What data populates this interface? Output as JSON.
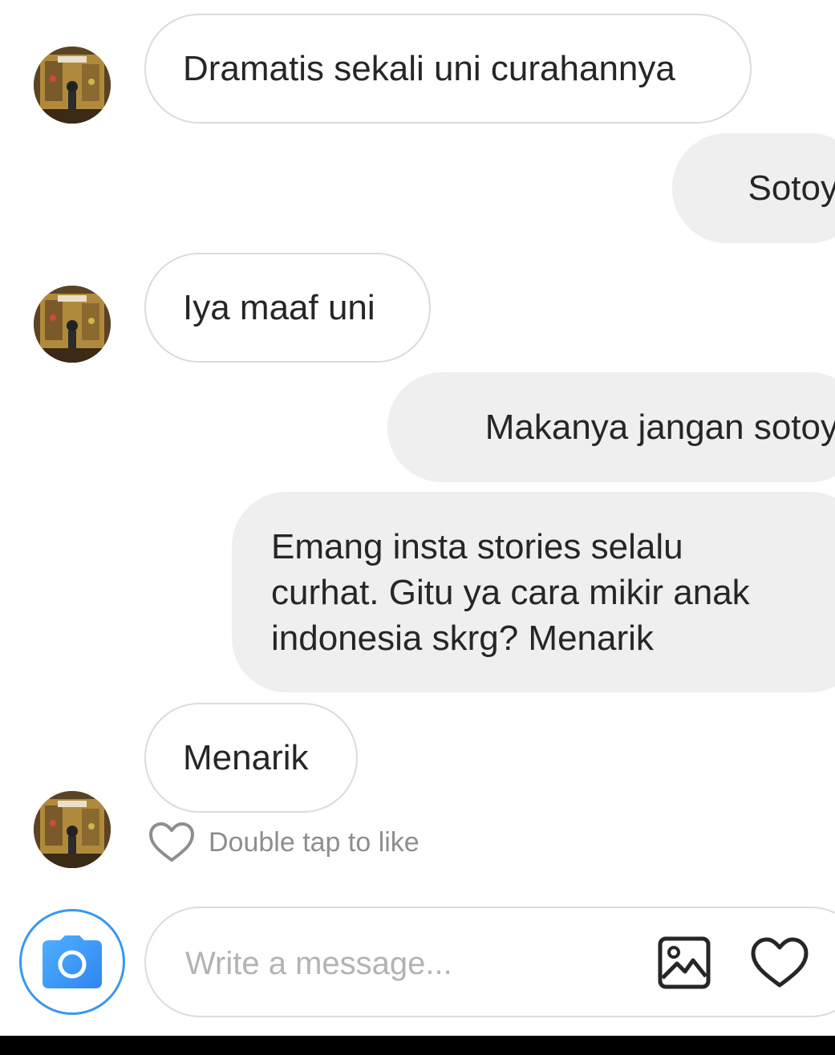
{
  "messages": [
    {
      "sender": "them",
      "text": "Dramatis sekali uni curahannya"
    },
    {
      "sender": "me",
      "text": "Sotoy"
    },
    {
      "sender": "them",
      "text": "Iya maaf uni"
    },
    {
      "sender": "me",
      "text": "Makanya jangan sotoy"
    },
    {
      "sender": "me",
      "lines": [
        "Emang insta stories selalu",
        "curhat. Gitu ya cara mikir anak",
        "indonesia skrg? Menarik"
      ]
    },
    {
      "sender": "them",
      "text": "Menarik"
    }
  ],
  "like_hint": "Double tap to like",
  "composer": {
    "placeholder": "Write a message...",
    "icons": [
      "camera-icon",
      "image-icon",
      "heart-icon"
    ]
  },
  "colors": {
    "accent": "#3897f0",
    "incoming_border": "#dbdbdb",
    "outgoing_bg": "#efefef",
    "text": "#262626",
    "muted": "#8e8e8e"
  }
}
